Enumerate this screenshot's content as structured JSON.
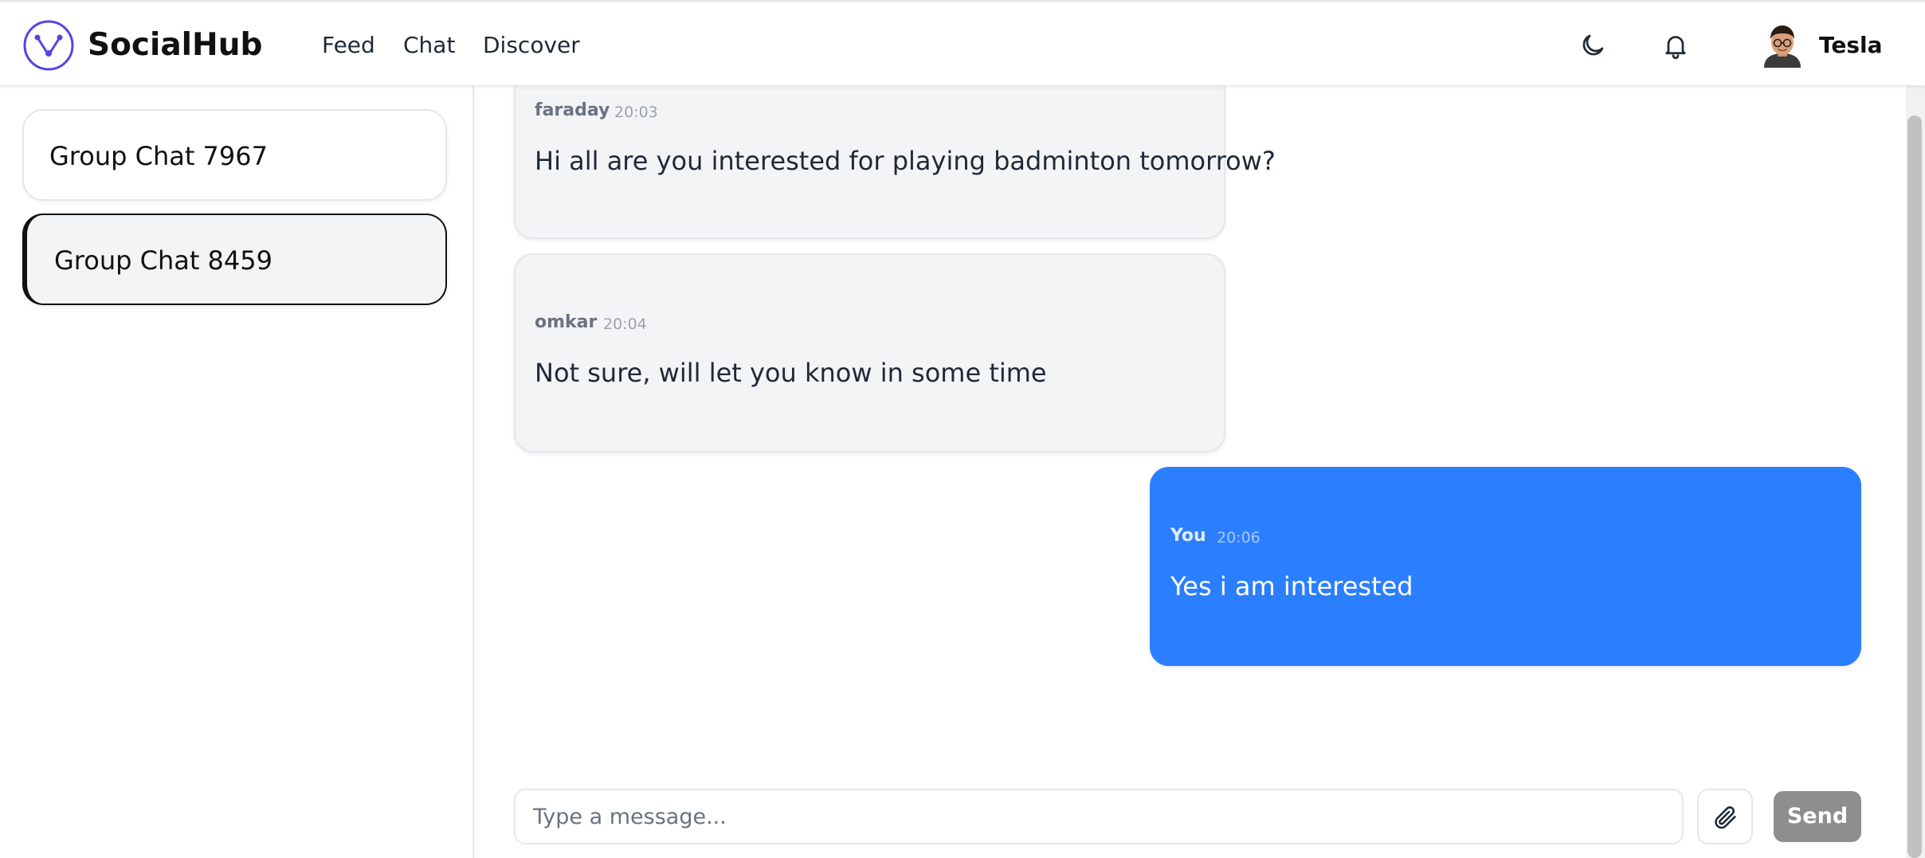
{
  "header": {
    "brand": "SocialHub",
    "nav": [
      {
        "label": "Feed"
      },
      {
        "label": "Chat"
      },
      {
        "label": "Discover"
      }
    ],
    "user": {
      "name": "Tesla"
    },
    "icons": {
      "logo": "network-logo-icon",
      "theme": "moon-icon",
      "notifications": "bell-icon",
      "avatar": "user-avatar-icon"
    }
  },
  "sidebar": {
    "groups": [
      {
        "label": "Group Chat 7967",
        "active": false
      },
      {
        "label": "Group Chat 8459",
        "active": true
      }
    ]
  },
  "chat": {
    "messages": [
      {
        "sender": "faraday",
        "time": "20:03",
        "text": "Hi all are you interested for playing badminton tomorrow?",
        "mine": false
      },
      {
        "sender": "omkar",
        "time": "20:04",
        "text": "Not sure, will let you know in some time",
        "mine": false
      },
      {
        "sender": "You",
        "time": "20:06",
        "text": "Yes i am interested",
        "mine": true
      }
    ]
  },
  "composer": {
    "placeholder": "Type a message...",
    "value": "",
    "attach_icon": "paperclip-icon",
    "send_label": "Send"
  },
  "colors": {
    "accent": "#2b7fff",
    "send_disabled": "#8e8e8e",
    "bubble_other": "#f3f4f6"
  }
}
